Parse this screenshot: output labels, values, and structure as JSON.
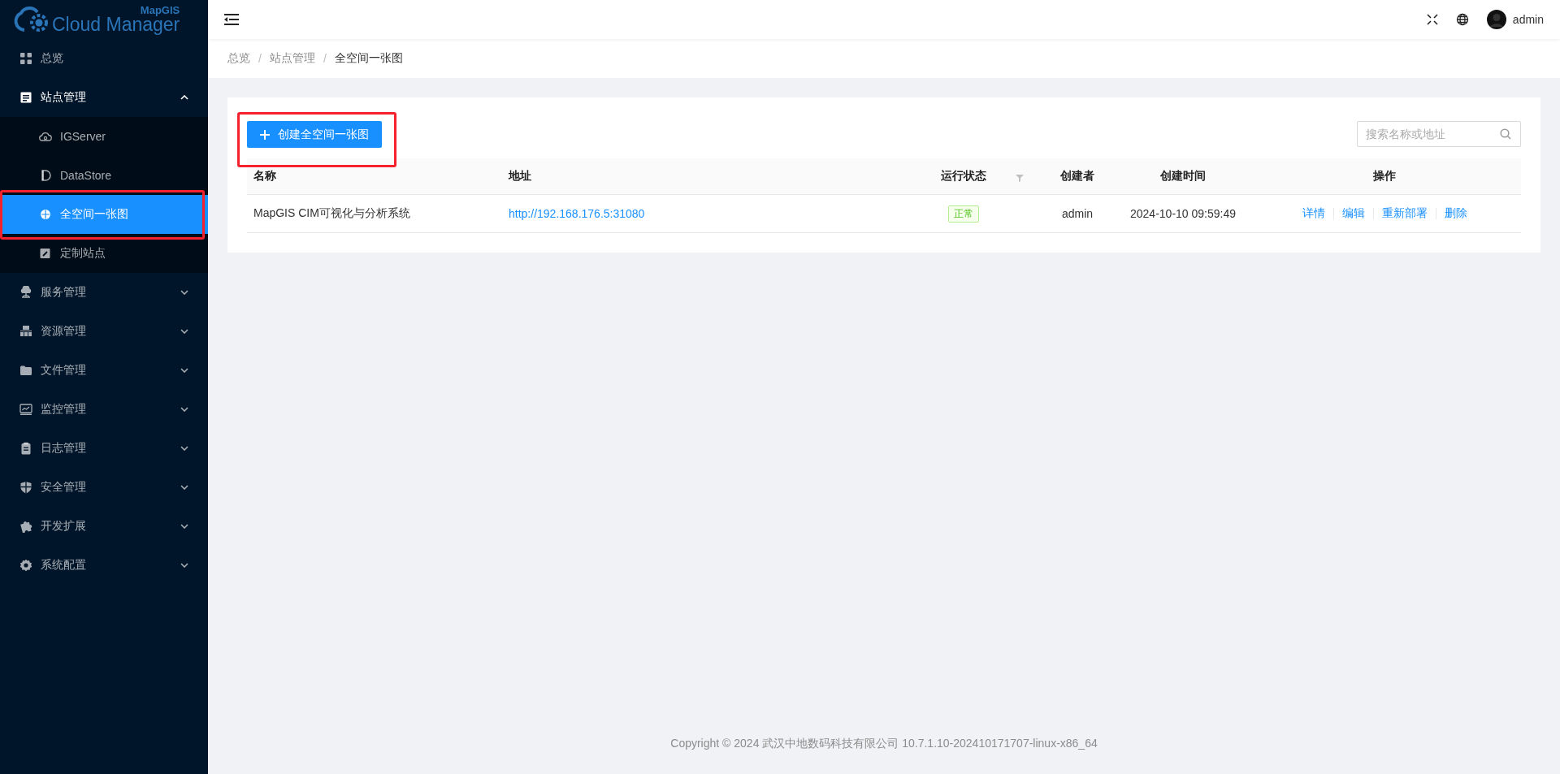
{
  "logo": {
    "caption": "MapGIS",
    "title": "Cloud Manager"
  },
  "sidebar": {
    "items": [
      {
        "label": "总览",
        "selected": false,
        "highlighted": false
      },
      {
        "label": "站点管理",
        "selected": false,
        "expanded": true,
        "highlighted": false,
        "children": [
          {
            "label": "IGServer",
            "selected": false,
            "highlighted": false
          },
          {
            "label": "DataStore",
            "selected": false,
            "highlighted": false
          },
          {
            "label": "全空间一张图",
            "selected": true,
            "highlighted": true
          },
          {
            "label": "定制站点",
            "selected": false,
            "highlighted": false
          }
        ]
      },
      {
        "label": "服务管理",
        "selected": false,
        "expanded": false,
        "highlighted": false
      },
      {
        "label": "资源管理",
        "selected": false,
        "expanded": false,
        "highlighted": false
      },
      {
        "label": "文件管理",
        "selected": false,
        "expanded": false,
        "highlighted": false
      },
      {
        "label": "监控管理",
        "selected": false,
        "expanded": false,
        "highlighted": false
      },
      {
        "label": "日志管理",
        "selected": false,
        "expanded": false,
        "highlighted": false
      },
      {
        "label": "安全管理",
        "selected": false,
        "expanded": false,
        "highlighted": false
      },
      {
        "label": "开发扩展",
        "selected": false,
        "expanded": false,
        "highlighted": false
      },
      {
        "label": "系统配置",
        "selected": false,
        "expanded": false,
        "highlighted": false
      }
    ]
  },
  "header": {
    "user": "admin"
  },
  "breadcrumb": [
    {
      "label": "总览",
      "current": false
    },
    {
      "separator": "/",
      "label": "站点管理",
      "current": false
    },
    {
      "separator": "/",
      "label": "全空间一张图",
      "current": true
    }
  ],
  "toolbar": {
    "create_button": {
      "label": "创建全空间一张图",
      "highlighted": true
    },
    "search": {
      "placeholder": "搜索名称或地址"
    }
  },
  "table": {
    "columns": [
      {
        "label": "名称"
      },
      {
        "label": "地址"
      },
      {
        "label": "运行状态",
        "filterable": true
      },
      {
        "label": "创建者"
      },
      {
        "label": "创建时间"
      },
      {
        "label": "操作"
      }
    ],
    "rows": [
      {
        "name": "MapGIS CIM可视化与分析系统",
        "address": "http://192.168.176.5:31080",
        "status": {
          "text": "正常",
          "kind": "success"
        },
        "creator": "admin",
        "created": "2024-10-10 09:59:49",
        "actions": [
          "详情",
          "编辑",
          "重新部署",
          "删除"
        ]
      }
    ]
  },
  "footer": "Copyright © 2024 武汉中地数码科技有限公司 10.7.1.10-202410171707-linux-x86_64"
}
